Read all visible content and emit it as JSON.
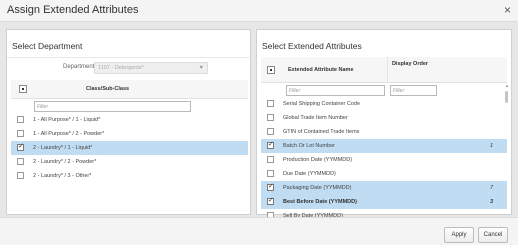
{
  "dialog": {
    "title": "Assign Extended Attributes",
    "close_icon": "×"
  },
  "left_panel": {
    "title": "Select Department",
    "department_label": "Department",
    "department_value": "1107 - Detergents*",
    "column_header": "Class/Sub-Class",
    "filter_placeholder": "Filter",
    "rows": [
      {
        "label": "1 - All Purpose* / 1 - Liquid*",
        "checked": false,
        "selected": false
      },
      {
        "label": "1 - All Purpose* / 2 - Powder*",
        "checked": false,
        "selected": false
      },
      {
        "label": "2 - Laundry* / 1 - Liquid*",
        "checked": true,
        "selected": true
      },
      {
        "label": "2 - Laundry* / 2 - Powder*",
        "checked": false,
        "selected": false
      },
      {
        "label": "2 - Laundry* / 3 - Other*",
        "checked": false,
        "selected": false
      }
    ]
  },
  "right_panel": {
    "title": "Select Extended Attributes",
    "col_name": "Extended Attribute Name",
    "col_order": "Display Order",
    "filter_placeholder": "Filter",
    "order_filter_placeholder": "Filter",
    "rows": [
      {
        "label": "Serial Shipping Container Code",
        "checked": false,
        "selected": false,
        "order": "",
        "bold": false
      },
      {
        "label": "Global Trade Item Number",
        "checked": false,
        "selected": false,
        "order": "",
        "bold": false
      },
      {
        "label": "GTIN of Contained Trade Items",
        "checked": false,
        "selected": false,
        "order": "",
        "bold": false
      },
      {
        "label": "Batch Or Lot Number",
        "checked": true,
        "selected": true,
        "order": "1",
        "bold": false
      },
      {
        "label": "Production Date (YYMMDD)",
        "checked": false,
        "selected": false,
        "order": "",
        "bold": false
      },
      {
        "label": "Due Date (YYMMDD)",
        "checked": false,
        "selected": false,
        "order": "",
        "bold": false
      },
      {
        "label": "Packaging Date (YYMMDD)",
        "checked": true,
        "selected": true,
        "order": "7",
        "bold": false
      },
      {
        "label": "Best Before Date (YYMMDD)",
        "checked": true,
        "selected": true,
        "order": "3",
        "bold": true
      },
      {
        "label": "Sell By Date (YYMMDD)",
        "checked": false,
        "selected": false,
        "order": "",
        "bold": false
      }
    ]
  },
  "footer": {
    "apply_label": "Apply",
    "cancel_label": "Cancel"
  }
}
